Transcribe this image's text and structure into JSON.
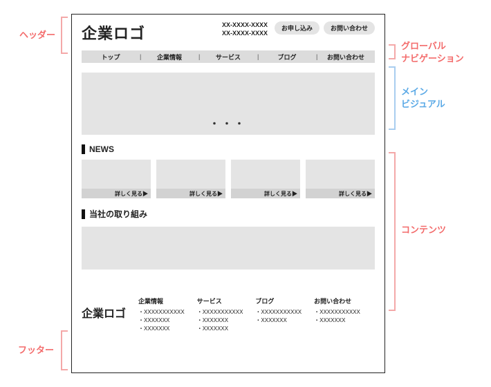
{
  "header": {
    "logo": "企業ロゴ",
    "phone1": "XX-XXXX-XXXX",
    "phone2": "XX-XXXX-XXXX",
    "cta_apply": "お申し込み",
    "cta_contact": "お問い合わせ"
  },
  "gnav": {
    "items": [
      "トップ",
      "企業情報",
      "サービス",
      "ブログ",
      "お問い合わせ"
    ]
  },
  "mv": {
    "dots": "・・・"
  },
  "news": {
    "heading": "NEWS",
    "more_label": "詳しく見る▶"
  },
  "feature": {
    "heading": "当社の取り組み"
  },
  "footer": {
    "logo": "企業ロゴ",
    "cols": [
      {
        "h": "企業情報",
        "items": [
          "XXXXXXXXXXX",
          "XXXXXXX",
          "XXXXXXX"
        ]
      },
      {
        "h": "サービス",
        "items": [
          "XXXXXXXXXXX",
          "XXXXXXX",
          "XXXXXXX"
        ]
      },
      {
        "h": "ブログ",
        "items": [
          "XXXXXXXXXXX",
          "XXXXXXX"
        ]
      },
      {
        "h": "お問い合わせ",
        "items": [
          "XXXXXXXXXXX",
          "XXXXXXX"
        ]
      }
    ]
  },
  "annotations": {
    "header": "ヘッダー",
    "gnav_l1": "グローバル",
    "gnav_l2": "ナビゲーション",
    "mv_l1": "メイン",
    "mv_l2": "ビジュアル",
    "contents": "コンテンツ",
    "footer": "フッター"
  }
}
